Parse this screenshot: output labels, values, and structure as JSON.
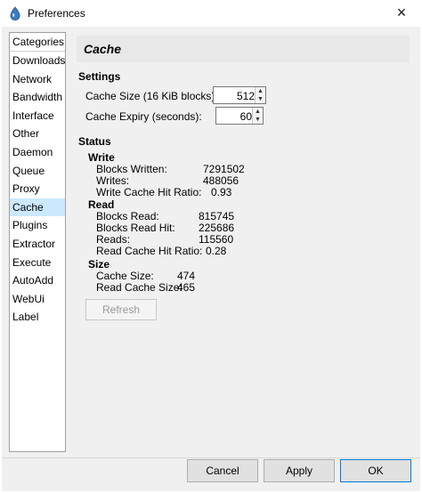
{
  "window": {
    "title": "Preferences",
    "close_glyph": "×"
  },
  "categories": {
    "header": "Categories",
    "items": [
      "Downloads",
      "Network",
      "Bandwidth",
      "Interface",
      "Other",
      "Daemon",
      "Queue",
      "Proxy",
      "Cache",
      "Plugins",
      "Extractor",
      "Execute",
      "AutoAdd",
      "WebUi",
      "Label"
    ],
    "selected": "Cache"
  },
  "panel": {
    "title": "Cache",
    "settings": {
      "heading": "Settings",
      "cache_size_label": "Cache Size (16 KiB blocks):",
      "cache_size_value": "512",
      "cache_expiry_label": "Cache Expiry (seconds):",
      "cache_expiry_value": "60"
    },
    "status": {
      "heading": "Status",
      "write": {
        "heading": "Write",
        "blocks_written_label": "Blocks Written:",
        "blocks_written_value": "7291502",
        "writes_label": "Writes:",
        "writes_value": "488056",
        "hit_ratio_label": "Write Cache Hit Ratio:",
        "hit_ratio_value": "0.93"
      },
      "read": {
        "heading": "Read",
        "blocks_read_label": "Blocks Read:",
        "blocks_read_value": "815745",
        "blocks_read_hit_label": "Blocks Read Hit:",
        "blocks_read_hit_value": "225686",
        "reads_label": "Reads:",
        "reads_value": "115560",
        "hit_ratio_label": "Read Cache Hit Ratio:",
        "hit_ratio_value": "0.28"
      },
      "size": {
        "heading": "Size",
        "cache_size_label": "Cache Size:",
        "cache_size_value": "474",
        "read_cache_size_label": "Read Cache Size:",
        "read_cache_size_value": "465"
      }
    },
    "refresh_label": "Refresh"
  },
  "buttons": {
    "cancel": "Cancel",
    "apply": "Apply",
    "ok": "OK"
  },
  "colors": {
    "selection": "#cce8ff",
    "ok_border": "#0078d7",
    "accent_icon": "#3b7cc4"
  }
}
